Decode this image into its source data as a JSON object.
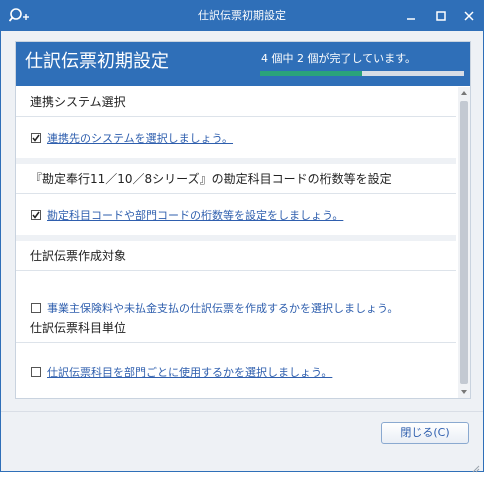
{
  "window": {
    "title": "仕訳伝票初期設定"
  },
  "header": {
    "title": "仕訳伝票初期設定",
    "status": "4 個中 2 個が完了しています。",
    "progress": 0.5
  },
  "sections": [
    {
      "heading": "連携システム選択",
      "item": "連携先のシステムを選択しましょう。",
      "checked": true
    },
    {
      "heading": "『勘定奉行11／10／8シリーズ』の勘定科目コードの桁数等を設定",
      "item": "勘定科目コードや部門コードの桁数等を設定をしましょう。",
      "checked": true
    },
    {
      "heading": "仕訳伝票作成対象",
      "item": "事業主保険料や未払金支払の仕訳伝票を作成するかを選択しましょう。",
      "checked": false,
      "highlighted": true
    },
    {
      "heading": "仕訳伝票科目単位",
      "item": "仕訳伝票科目を部門ごとに使用するかを選択しましょう。",
      "checked": false
    }
  ],
  "footer": {
    "close_label": "閉じる(C)"
  },
  "colors": {
    "title_bar": "#2f6fb8",
    "progress": "#2aa37a",
    "highlight": "#d00e0e",
    "link": "#2f5fae"
  }
}
